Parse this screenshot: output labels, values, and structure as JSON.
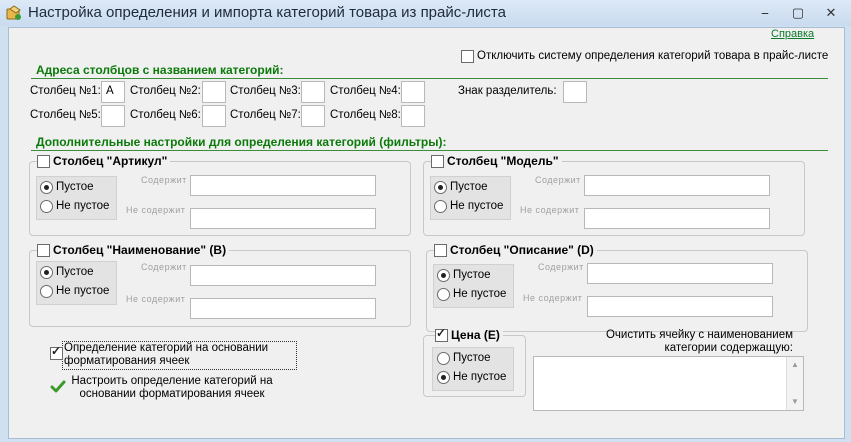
{
  "window": {
    "title": "Настройка определения и импорта категорий товара из прайс-листа",
    "controls": {
      "minimize": "⎯",
      "maximize": "▢",
      "close": "✕"
    }
  },
  "help_link": "Справка",
  "disable_system": {
    "label": "Отключить систему определения категорий товара в прайс-листе",
    "checked": false
  },
  "columns_section": {
    "title": "Адреса столбцов с названием категорий:",
    "fields": [
      {
        "label": "Столбец №1:",
        "value": "A"
      },
      {
        "label": "Столбец №2:",
        "value": ""
      },
      {
        "label": "Столбец №3:",
        "value": ""
      },
      {
        "label": "Столбец №4:",
        "value": ""
      },
      {
        "label": "Столбец №5:",
        "value": ""
      },
      {
        "label": "Столбец №6:",
        "value": ""
      },
      {
        "label": "Столбец №7:",
        "value": ""
      },
      {
        "label": "Столбец №8:",
        "value": ""
      }
    ],
    "separator": {
      "label": "Знак разделитель:",
      "value": ""
    }
  },
  "filters_section": {
    "title": "Дополнительные настройки для определения категорий (фильтры):",
    "groups": [
      {
        "title": "Столбец \"Артикул\"",
        "empty": "Пустое",
        "not_empty": "Не пустое",
        "contains": "Содержит",
        "not_contains": "Не содержит",
        "selected": "empty"
      },
      {
        "title": "Столбец \"Модель\"",
        "empty": "Пустое",
        "not_empty": "Не пустое",
        "contains": "Содержит",
        "not_contains": "Не содержит",
        "selected": "empty"
      },
      {
        "title": "Столбец \"Наименование\" (B)",
        "empty": "Пустое",
        "not_empty": "Не пустое",
        "contains": "Содержит",
        "not_contains": "Не содержит",
        "selected": "empty"
      },
      {
        "title": "Столбец \"Описание\" (D)",
        "empty": "Пустое",
        "not_empty": "Не пустое",
        "contains": "Содержит",
        "not_contains": "Не содержит",
        "selected": "empty"
      }
    ],
    "price": {
      "title": "Цена (E)",
      "checked": true,
      "empty": "Пустое",
      "not_empty": "Не пустое",
      "selected": "not_empty"
    }
  },
  "format_detection": {
    "label": "Определение категорий на основании форматирования ячеек",
    "checked": true
  },
  "configure_format": {
    "label": "Настроить определение категорий на основании форматирования ячеек"
  },
  "clear_cell": {
    "label": "Очистить ячейку с наименованием категории содержащую:",
    "value": ""
  }
}
